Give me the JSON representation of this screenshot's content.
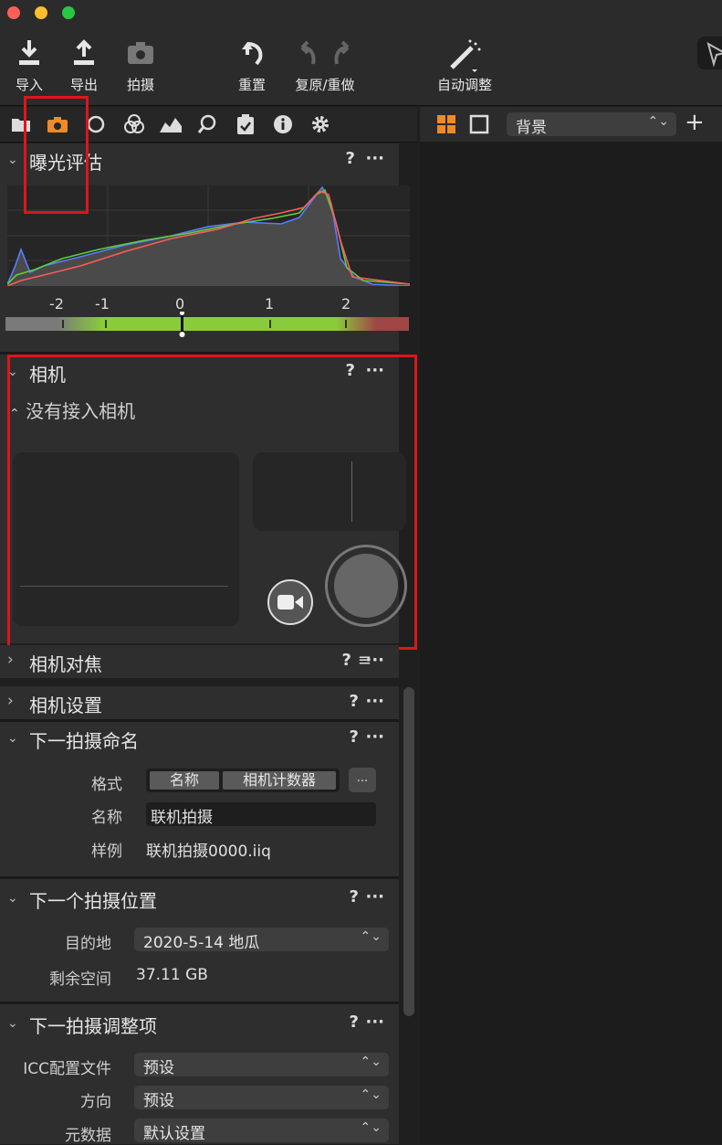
{
  "toolbar": {
    "import": "导入",
    "export": "导出",
    "capture": "拍摄",
    "reset": "重置",
    "undo_redo": "复原/重做",
    "auto_adjust": "自动调整"
  },
  "right_panel": {
    "background_label": "背景"
  },
  "exposure": {
    "title": "曝光评估",
    "help": "?",
    "more": "···",
    "ticks": [
      "-2",
      "-1",
      "0",
      "1",
      "2"
    ]
  },
  "camera": {
    "title": "相机",
    "help": "?",
    "more": "···",
    "status": "没有接入相机"
  },
  "camera_focus": {
    "title": "相机对焦",
    "help": "?",
    "menu": "≡",
    "more": "···"
  },
  "camera_settings": {
    "title": "相机设置",
    "help": "?",
    "more": "···"
  },
  "next_capture_naming": {
    "title": "下一拍摄命名",
    "help": "?",
    "more": "···",
    "format_label": "格式",
    "format_token1": "名称",
    "format_token2": "相机计数器",
    "format_more": "...",
    "name_label": "名称",
    "name_value": "联机拍摄",
    "sample_label": "样例",
    "sample_value": "联机拍摄0000.iiq"
  },
  "next_capture_location": {
    "title": "下一个拍摄位置",
    "help": "?",
    "more": "···",
    "dest_label": "目的地",
    "dest_value": "2020-5-14 地瓜",
    "space_label": "剩余空间",
    "space_value": "37.11 GB"
  },
  "next_capture_adjustments": {
    "title": "下一拍摄调整项",
    "help": "?",
    "more": "···",
    "icc_label": "ICC配置文件",
    "icc_value": "预设",
    "orientation_label": "方向",
    "orientation_value": "预设",
    "metadata_label": "元数据",
    "metadata_value": "默认设置"
  },
  "colors": {
    "accent": "#f08a24",
    "highlight_box": "#e0141c",
    "exposure_good": "#8acb3c"
  }
}
